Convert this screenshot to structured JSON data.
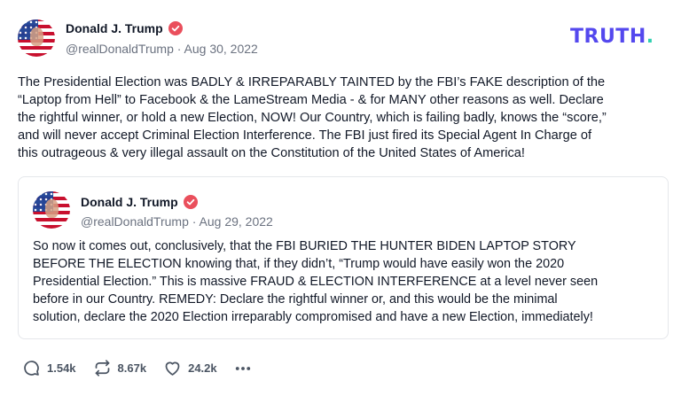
{
  "post": {
    "author_name": "Donald J. Trump",
    "handle_date": "@realDonaldTrump · Aug 30, 2022",
    "brand": "TRUTH",
    "brand_dot": ".",
    "text": "The Presidential Election was BADLY & IRREPARABLY TAINTED by the FBI’s FAKE description of the\n“Laptop from Hell” to Facebook & the LameStream Media - & for MANY other reasons as well. Declare\nthe rightful winner, or hold a new Election, NOW! Our Country, which is failing badly, knows the “score,”\nand will never accept Criminal Election Interference. The FBI just fired its Special Agent In Charge of\nthis outrageous & very illegal assault on the Constitution of the United States of America!"
  },
  "quoted": {
    "author_name": "Donald J. Trump",
    "handle_date": "@realDonaldTrump · Aug 29, 2022",
    "text": "So now it comes out, conclusively, that the FBI BURIED THE HUNTER BIDEN LAPTOP STORY\nBEFORE THE ELECTION knowing that, if they didn’t, “Trump would have easily won the 2020\nPresidential Election.” This is massive FRAUD & ELECTION INTERFERENCE at a  level never seen\nbefore in our Country. REMEDY: Declare the rightful winner or, and this would be the minimal\nsolution, declare the 2020 Election irreparably compromised and have a new Election, immediately!"
  },
  "actions": {
    "replies": "1.54k",
    "retruths": "8.67k",
    "likes": "24.2k"
  },
  "icons": {
    "verified": "verified-badge-icon",
    "reply": "comment-bubble-icon",
    "retruth": "repost-arrows-icon",
    "like": "heart-icon",
    "more": "more-dots-icon"
  },
  "colors": {
    "brand_purple": "#5448ee",
    "brand_teal": "#2fd0b0",
    "verified_red": "#ea4f5c",
    "muted": "#6b7280"
  }
}
